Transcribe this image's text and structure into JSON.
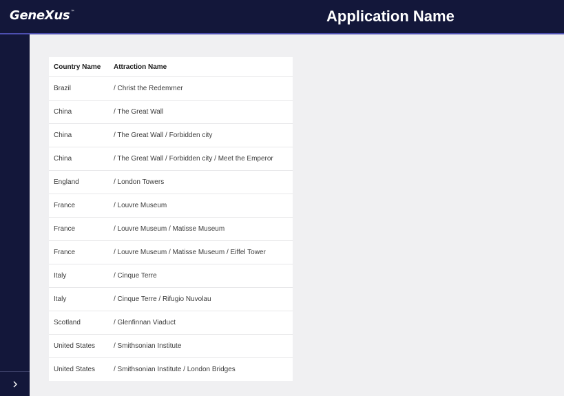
{
  "header": {
    "logo_text": "GeneXus",
    "logo_tm": "™",
    "app_title": "Application Name"
  },
  "sidebar": {
    "toggle_icon": "chevron-right-icon"
  },
  "grid": {
    "columns": [
      "Country Name",
      "Attraction Name"
    ],
    "rows": [
      [
        "Brazil",
        "/ Christ the Redemmer"
      ],
      [
        "China",
        "/ The Great Wall"
      ],
      [
        "China",
        "/ The Great Wall / Forbidden city"
      ],
      [
        "China",
        "/ The Great Wall / Forbidden city / Meet the Emperor"
      ],
      [
        "England",
        "/ London Towers"
      ],
      [
        "France",
        "/ Louvre Museum"
      ],
      [
        "France",
        "/ Louvre Museum / Matisse Museum"
      ],
      [
        "France",
        "/ Louvre Museum / Matisse Museum / Eiffel Tower"
      ],
      [
        "Italy",
        "/ Cinque Terre"
      ],
      [
        "Italy",
        "/ Cinque Terre / Rifugio Nuvolau"
      ],
      [
        "Scotland",
        "/ Glenfinnan Viaduct"
      ],
      [
        "United States",
        "/ Smithsonian Institute"
      ],
      [
        "United States",
        "/ Smithsonian Institute / London Bridges"
      ]
    ]
  },
  "colors": {
    "header_bg": "#13173a",
    "header_border": "#4d4fb0",
    "content_bg": "#f0f0f2"
  }
}
